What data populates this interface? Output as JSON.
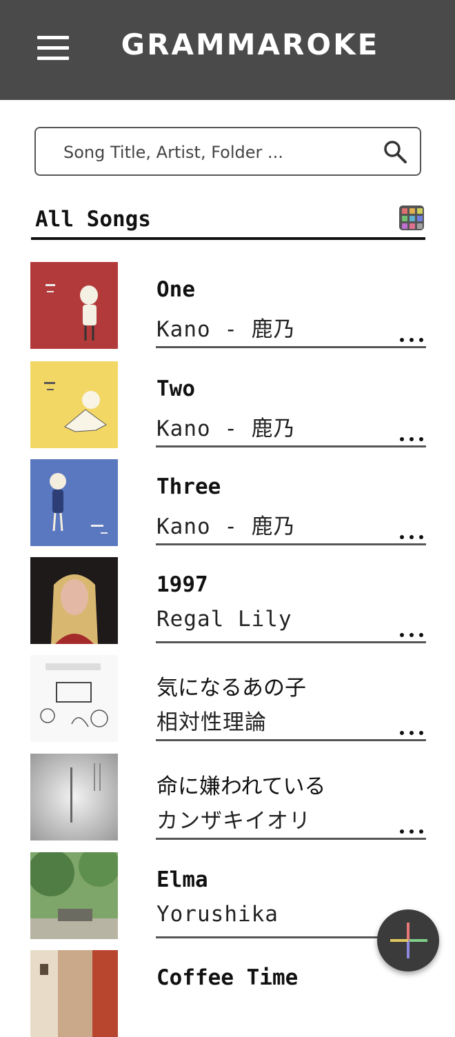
{
  "app": {
    "title": "GRAMMAROKE"
  },
  "search": {
    "placeholder": "Song Title, Artist, Folder ..."
  },
  "section": {
    "title": "All Songs"
  },
  "songs": [
    {
      "title": "One",
      "artist": "Kano - 鹿乃"
    },
    {
      "title": "Two",
      "artist": "Kano - 鹿乃"
    },
    {
      "title": "Three",
      "artist": "Kano - 鹿乃"
    },
    {
      "title": "1997",
      "artist": "Regal Lily"
    },
    {
      "title": "気になるあの子",
      "artist": "相対性理論"
    },
    {
      "title": "命に嫌われている",
      "artist": "カンザキイオリ"
    },
    {
      "title": "Elma",
      "artist": "Yorushika"
    },
    {
      "title": "Coffee Time",
      "artist": ""
    }
  ],
  "colors": {
    "appbar": "#4a4a4a",
    "fab": "#3b3b3b"
  },
  "icons": {
    "menu": "hamburger-icon",
    "search": "search-icon",
    "view": "grid-view-icon",
    "more": "more-horizontal-icon",
    "fab": "add-icon"
  }
}
